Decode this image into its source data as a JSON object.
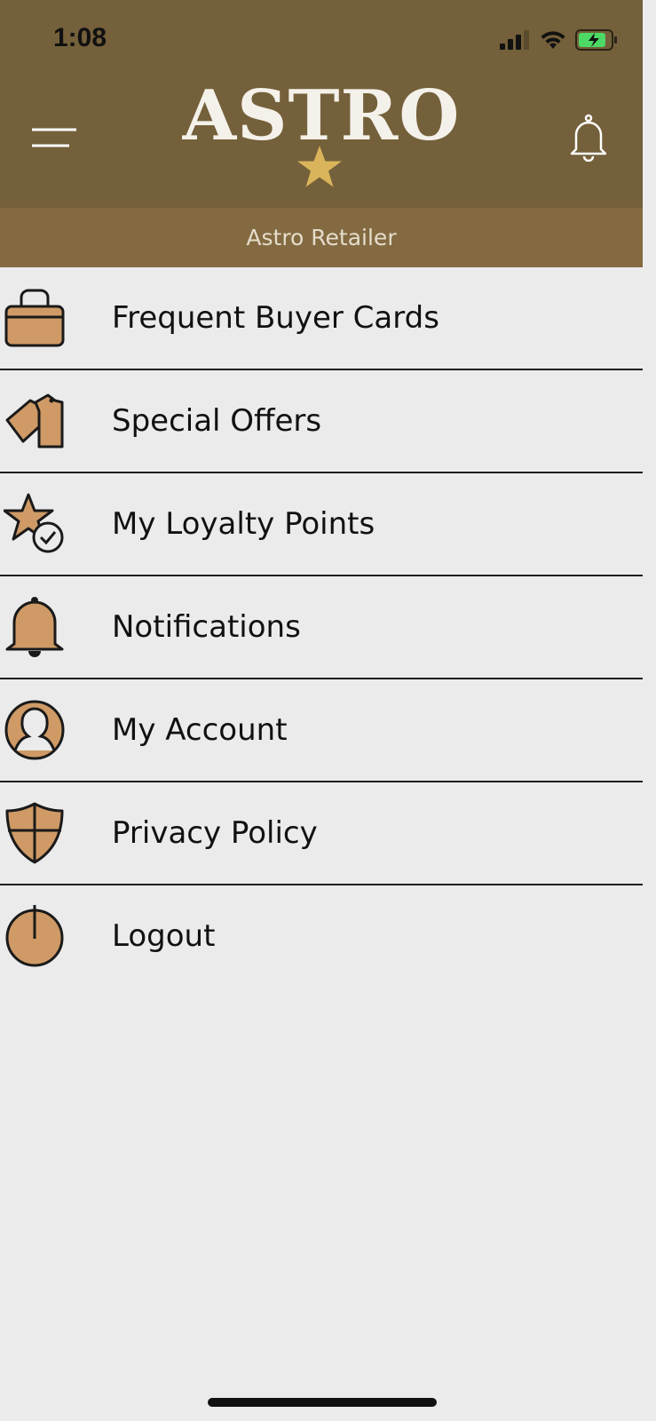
{
  "status_bar": {
    "time": "1:08"
  },
  "header": {
    "logo_text": "ASTRO",
    "subtitle": "Astro Retailer"
  },
  "menu": {
    "items": [
      {
        "label": "Frequent Buyer Cards",
        "icon": "shopping-bag-icon"
      },
      {
        "label": "Special Offers",
        "icon": "price-tag-icon"
      },
      {
        "label": "My Loyalty Points",
        "icon": "star-check-icon"
      },
      {
        "label": "Notifications",
        "icon": "bell-icon"
      },
      {
        "label": "My Account",
        "icon": "user-avatar-icon"
      },
      {
        "label": "Privacy Policy",
        "icon": "shield-icon"
      },
      {
        "label": "Logout",
        "icon": "power-icon"
      }
    ]
  },
  "colors": {
    "header_bg": "#74603a",
    "subheader_bg": "#836a41",
    "page_bg": "#ebebeb",
    "icon_fill": "#cf9a66",
    "logo_star": "#d9b45a"
  }
}
